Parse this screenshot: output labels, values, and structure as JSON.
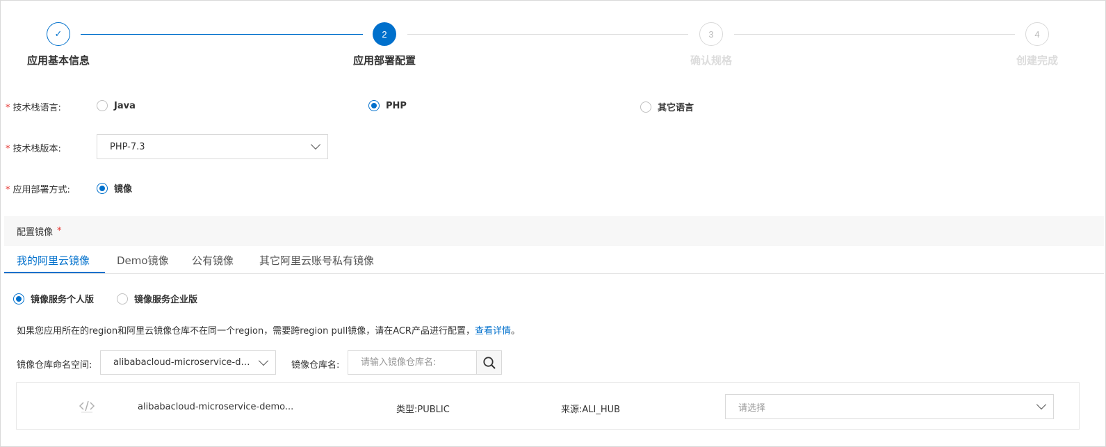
{
  "colors": {
    "accent": "#0070cc",
    "required": "#e5322d",
    "inactive_text": "#d9d9d9"
  },
  "steps": [
    {
      "number": "✓",
      "label": "应用基本信息",
      "state": "done"
    },
    {
      "number": "2",
      "label": "应用部署配置",
      "state": "active"
    },
    {
      "number": "3",
      "label": "确认规格",
      "state": "pending"
    },
    {
      "number": "4",
      "label": "创建完成",
      "state": "pending"
    }
  ],
  "form": {
    "required_mark": "*",
    "stack_language": {
      "label": "技术栈语言:",
      "options": [
        "Java",
        "PHP",
        "其它语言"
      ],
      "selected": "PHP"
    },
    "stack_version": {
      "label": "技术栈版本:",
      "value": "PHP-7.3"
    },
    "deploy_method": {
      "label": "应用部署方式:",
      "options": [
        "镜像"
      ],
      "selected": "镜像"
    }
  },
  "image_section": {
    "title": "配置镜像",
    "required_mark": "*",
    "tabs": [
      "我的阿里云镜像",
      "Demo镜像",
      "公有镜像",
      "其它阿里云账号私有镜像"
    ],
    "active_tab": "我的阿里云镜像",
    "edition": {
      "options": [
        "镜像服务个人版",
        "镜像服务企业版"
      ],
      "selected": "镜像服务个人版"
    },
    "hint_text": "如果您应用所在的region和阿里云镜像仓库不在同一个region，需要跨region pull镜像，请在ACR产品进行配置，",
    "hint_link": "查看详情",
    "hint_end": "。",
    "namespace_label": "镜像仓库命名空间:",
    "namespace_value": "alibabacloud-microservice-demo",
    "repo_name_label": "镜像仓库名:",
    "repo_name_placeholder": "请输入镜像仓库名:",
    "repo_row": {
      "icon": "code-icon",
      "name": "alibabacloud-microservice-demo...",
      "type": "类型:PUBLIC",
      "source": "来源:ALI_HUB",
      "version_placeholder": "请选择"
    }
  }
}
